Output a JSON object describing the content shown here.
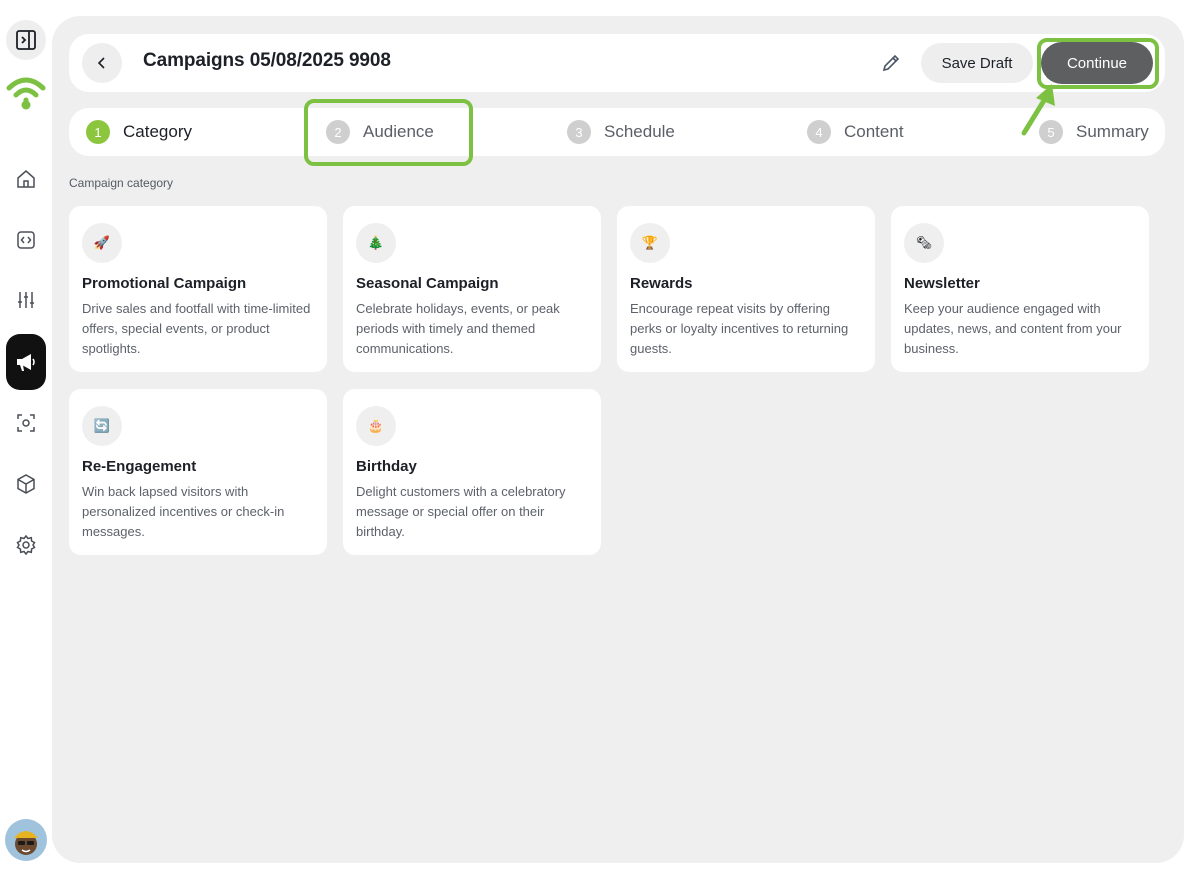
{
  "header": {
    "title": "Campaigns 05/08/2025 9908",
    "save_label": "Save Draft",
    "continue_label": "Continue"
  },
  "steps": [
    {
      "num": "1",
      "label": "Category"
    },
    {
      "num": "2",
      "label": "Audience"
    },
    {
      "num": "3",
      "label": "Schedule"
    },
    {
      "num": "4",
      "label": "Content"
    },
    {
      "num": "5",
      "label": "Summary"
    }
  ],
  "section_label": "Campaign category",
  "cards": [
    {
      "icon": "🚀",
      "title": "Promotional Campaign",
      "desc": "Drive sales and footfall with time-limited offers, special events, or product spotlights."
    },
    {
      "icon": "🎄",
      "title": "Seasonal Campaign",
      "desc": "Celebrate holidays, events, or peak periods with timely and themed communications."
    },
    {
      "icon": "🏆",
      "title": "Rewards",
      "desc": "Encourage repeat visits by offering perks or loyalty incentives to returning guests."
    },
    {
      "icon": "🗞",
      "title": "Newsletter",
      "desc": "Keep your audience engaged with updates, news, and content from your business."
    },
    {
      "icon": "🔄",
      "title": "Re-Engagement",
      "desc": "Win back lapsed visitors with personalized incentives or check-in messages."
    },
    {
      "icon": "🎂",
      "title": "Birthday",
      "desc": "Delight customers with a celebratory message or special offer on their birthday."
    }
  ],
  "colors": {
    "accent": "#8cc63f",
    "highlight": "#7dc142",
    "continue_bg": "#5e5f61",
    "panel_bg": "#efefef"
  },
  "icons": [
    "sidebar-toggle-icon",
    "wifi-logo-icon",
    "home-icon",
    "code-icon",
    "sliders-icon",
    "megaphone-icon",
    "scan-icon",
    "box-icon",
    "settings-icon",
    "chevron-left-icon",
    "pencil-icon"
  ]
}
